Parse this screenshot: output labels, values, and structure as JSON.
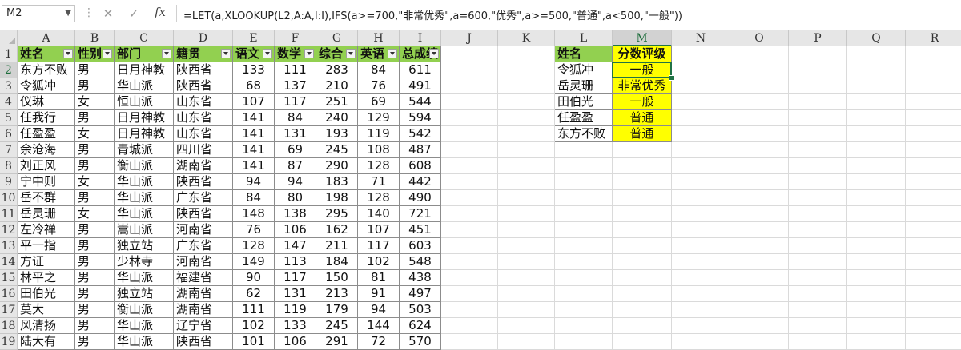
{
  "formula_bar": {
    "name_box": "M2",
    "cancel_icon": "✕",
    "enter_icon": "✓",
    "fx_label": "fx",
    "formula": "=LET(a,XLOOKUP(L2,A:A,I:I),IFS(a>=700,\"非常优秀\",a=600,\"优秀\",a>=500,\"普通\",a<500,\"一般\"))"
  },
  "columns": [
    "A",
    "B",
    "C",
    "D",
    "E",
    "F",
    "G",
    "H",
    "I",
    "J",
    "K",
    "L",
    "M",
    "N",
    "O",
    "P",
    "Q",
    "R"
  ],
  "rows": [
    "1",
    "2",
    "3",
    "4",
    "5",
    "6",
    "7",
    "8",
    "9",
    "10",
    "11",
    "12",
    "13",
    "14",
    "15",
    "16",
    "17",
    "18",
    "19"
  ],
  "main_table": {
    "headers": [
      "姓名",
      "性别",
      "部门",
      "籍贯",
      "语文",
      "数学",
      "综合",
      "英语",
      "总成绩"
    ],
    "rows": [
      [
        "东方不败",
        "男",
        "日月神教",
        "陕西省",
        "133",
        "111",
        "283",
        "84",
        "611"
      ],
      [
        "令狐冲",
        "男",
        "华山派",
        "陕西省",
        "68",
        "137",
        "210",
        "76",
        "491"
      ],
      [
        "仪琳",
        "女",
        "恒山派",
        "山东省",
        "107",
        "117",
        "251",
        "69",
        "544"
      ],
      [
        "任我行",
        "男",
        "日月神教",
        "山东省",
        "141",
        "84",
        "240",
        "129",
        "594"
      ],
      [
        "任盈盈",
        "女",
        "日月神教",
        "山东省",
        "141",
        "131",
        "193",
        "119",
        "542"
      ],
      [
        "余沧海",
        "男",
        "青城派",
        "四川省",
        "141",
        "69",
        "245",
        "108",
        "487"
      ],
      [
        "刘正风",
        "男",
        "衡山派",
        "湖南省",
        "141",
        "87",
        "290",
        "128",
        "608"
      ],
      [
        "宁中则",
        "女",
        "华山派",
        "陕西省",
        "94",
        "94",
        "183",
        "71",
        "442"
      ],
      [
        "岳不群",
        "男",
        "华山派",
        "广东省",
        "84",
        "80",
        "198",
        "128",
        "490"
      ],
      [
        "岳灵珊",
        "女",
        "华山派",
        "陕西省",
        "148",
        "138",
        "295",
        "140",
        "721"
      ],
      [
        "左冷禅",
        "男",
        "嵩山派",
        "河南省",
        "76",
        "106",
        "162",
        "107",
        "451"
      ],
      [
        "平一指",
        "男",
        "独立站",
        "广东省",
        "128",
        "147",
        "211",
        "117",
        "603"
      ],
      [
        "方证",
        "男",
        "少林寺",
        "河南省",
        "149",
        "113",
        "184",
        "102",
        "548"
      ],
      [
        "林平之",
        "男",
        "华山派",
        "福建省",
        "90",
        "117",
        "150",
        "81",
        "438"
      ],
      [
        "田伯光",
        "男",
        "独立站",
        "湖南省",
        "62",
        "131",
        "213",
        "91",
        "497"
      ],
      [
        "莫大",
        "男",
        "衡山派",
        "湖南省",
        "111",
        "119",
        "179",
        "94",
        "503"
      ],
      [
        "风清扬",
        "男",
        "华山派",
        "辽宁省",
        "102",
        "133",
        "245",
        "144",
        "624"
      ],
      [
        "陆大有",
        "男",
        "华山派",
        "陕西省",
        "101",
        "106",
        "291",
        "72",
        "570"
      ]
    ]
  },
  "lookup_table": {
    "headers": [
      "姓名",
      "分数评级"
    ],
    "rows": [
      [
        "令狐冲",
        "一般"
      ],
      [
        "岳灵珊",
        "非常优秀"
      ],
      [
        "田伯光",
        "一般"
      ],
      [
        "任盈盈",
        "普通"
      ],
      [
        "东方不败",
        "普通"
      ]
    ]
  },
  "colors": {
    "green_header": "#92d050",
    "yellow": "#ffff00",
    "selection": "#217346"
  }
}
